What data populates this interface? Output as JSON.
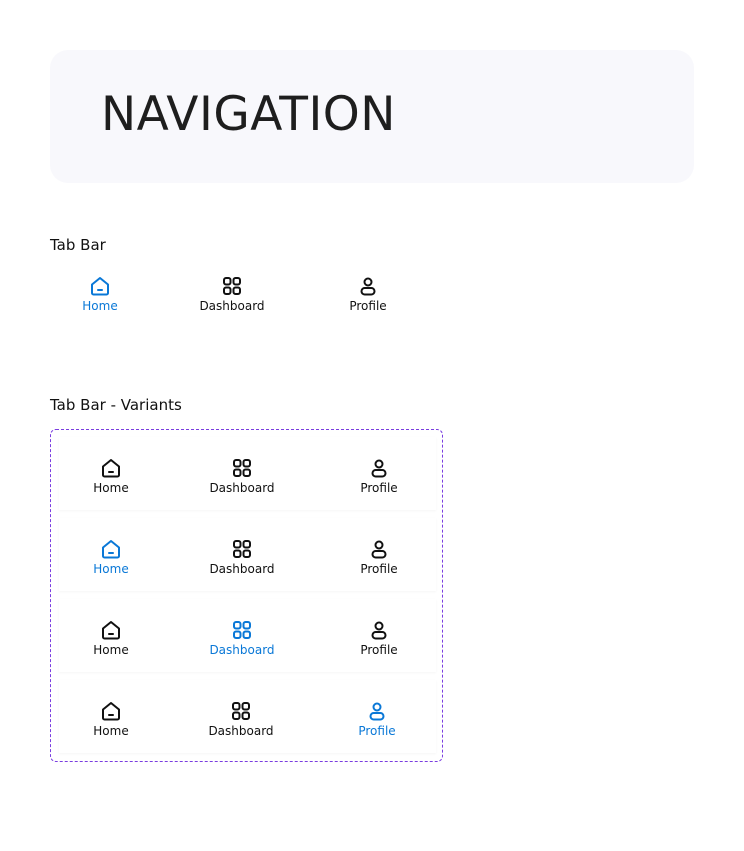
{
  "header": {
    "title": "NAVIGATION"
  },
  "sections": {
    "tabbar_label": "Tab Bar",
    "variants_label": "Tab Bar  - Variants"
  },
  "tabbar": {
    "tabs": [
      {
        "label": "Home",
        "icon": "home-icon",
        "active": true
      },
      {
        "label": "Dashboard",
        "icon": "dashboard-icon",
        "active": false
      },
      {
        "label": "Profile",
        "icon": "profile-icon",
        "active": false
      }
    ]
  },
  "variants": [
    {
      "tabs": [
        {
          "label": "Home"
        },
        {
          "label": "Dashboard"
        },
        {
          "label": "Profile"
        }
      ],
      "active": null
    },
    {
      "tabs": [
        {
          "label": "Home"
        },
        {
          "label": "Dashboard"
        },
        {
          "label": "Profile"
        }
      ],
      "active": "Home"
    },
    {
      "tabs": [
        {
          "label": "Home"
        },
        {
          "label": "Dashboard"
        },
        {
          "label": "Profile"
        }
      ],
      "active": "Dashboard"
    },
    {
      "tabs": [
        {
          "label": "Home"
        },
        {
          "label": "Dashboard"
        },
        {
          "label": "Profile"
        }
      ],
      "active": "Profile"
    }
  ],
  "colors": {
    "active": "#0a78d7",
    "inactive": "#111111",
    "variant_border": "#7a3de0",
    "header_bg": "#f8f8fc"
  }
}
